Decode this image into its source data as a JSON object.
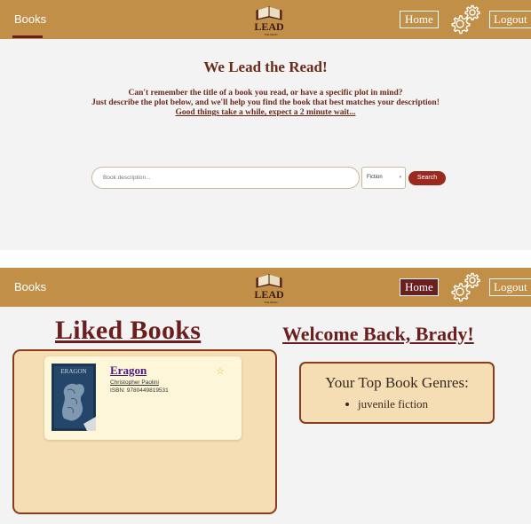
{
  "search_page": {
    "header": {
      "nav_books": "Books",
      "home_label": "Home",
      "logout_label": "Logout",
      "logo_text": "LEAD",
      "logo_subtext": "THE READ"
    },
    "title": "We Lead the Read!",
    "description_line1": "Can't remember the title of a book you read, or have a specific plot in mind?",
    "description_line2": "Just describe the plot below, and we'll help you find the book that best matches your description!",
    "wait_note": "Good things take a while, expect a 2 minute wait...",
    "search": {
      "placeholder": "Book description...",
      "genre_selected": "Fiction",
      "button_label": "Search"
    }
  },
  "profile_page": {
    "header": {
      "nav_books": "Books",
      "home_label": "Home",
      "logout_label": "Logout",
      "logo_text": "LEAD",
      "logo_subtext": "THE READ"
    },
    "liked_title": "Liked Books",
    "welcome": "Welcome Back, Brady!",
    "liked_books": [
      {
        "title": "Eragon",
        "author": "Christopher Paolini",
        "isbn": "ISBN: 9780449819531",
        "cover_text": "ERAGON"
      }
    ],
    "top_genres_title": "Your Top Book Genres:",
    "top_genres": [
      "juvenile fiction"
    ]
  },
  "colors": {
    "header": "#c18f48",
    "maroon": "#6b1e1e",
    "panel_bg": "#f5deb3",
    "search_button": "#9b2a1e"
  }
}
